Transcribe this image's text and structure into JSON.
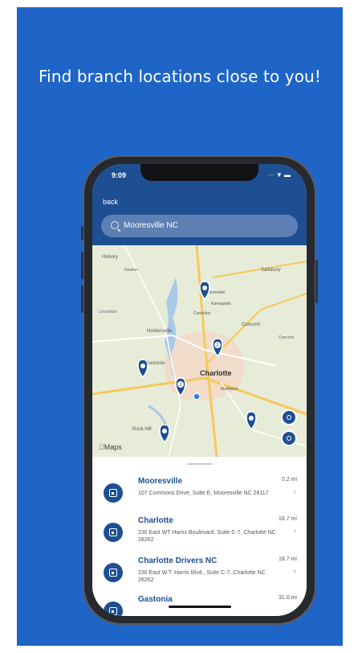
{
  "headline": "Find branch locations close to you!",
  "status": {
    "time": "9:09",
    "icons": "··· ▼ ▬"
  },
  "nav": {
    "back_label": "back"
  },
  "search": {
    "value": "Mooresville NC"
  },
  "map": {
    "attribution": "Maps",
    "places": [
      "Hickory",
      "Newton",
      "Salisbury",
      "Mooresville",
      "Kannapolis",
      "Concord",
      "Cornelius",
      "Huntersville",
      "Concord",
      "Charlotte",
      "Gastonia",
      "Matthews",
      "Rock Hill",
      "Lincolnton"
    ],
    "pins": [
      {
        "label": ""
      },
      {
        "label": "2"
      },
      {
        "label": ""
      },
      {
        "label": "2"
      },
      {
        "label": ""
      },
      {
        "label": ""
      }
    ],
    "location_button_icon": "location-arrow-icon",
    "recenter_button_icon": "recenter-icon"
  },
  "locations": [
    {
      "name": "Mooresville",
      "address": "107 Commons Drive, Suite E, Mooresville NC 28117",
      "distance": "0.2 mi"
    },
    {
      "name": "Charlotte",
      "address": "230 East WT Harris Boulevard, Suite C-7, Charlotte NC 28262",
      "distance": "18.7 mi"
    },
    {
      "name": "Charlotte Drivers  NC",
      "address": "230 East W.T. Harris Blvd., Suite C-7, Charlotte NC 28262",
      "distance": "18.7 mi"
    },
    {
      "name": "Gastonia",
      "address": "",
      "distance": "31.0 mi"
    }
  ],
  "colors": {
    "panel": "#1f65c8",
    "brand": "#1e4f92"
  }
}
